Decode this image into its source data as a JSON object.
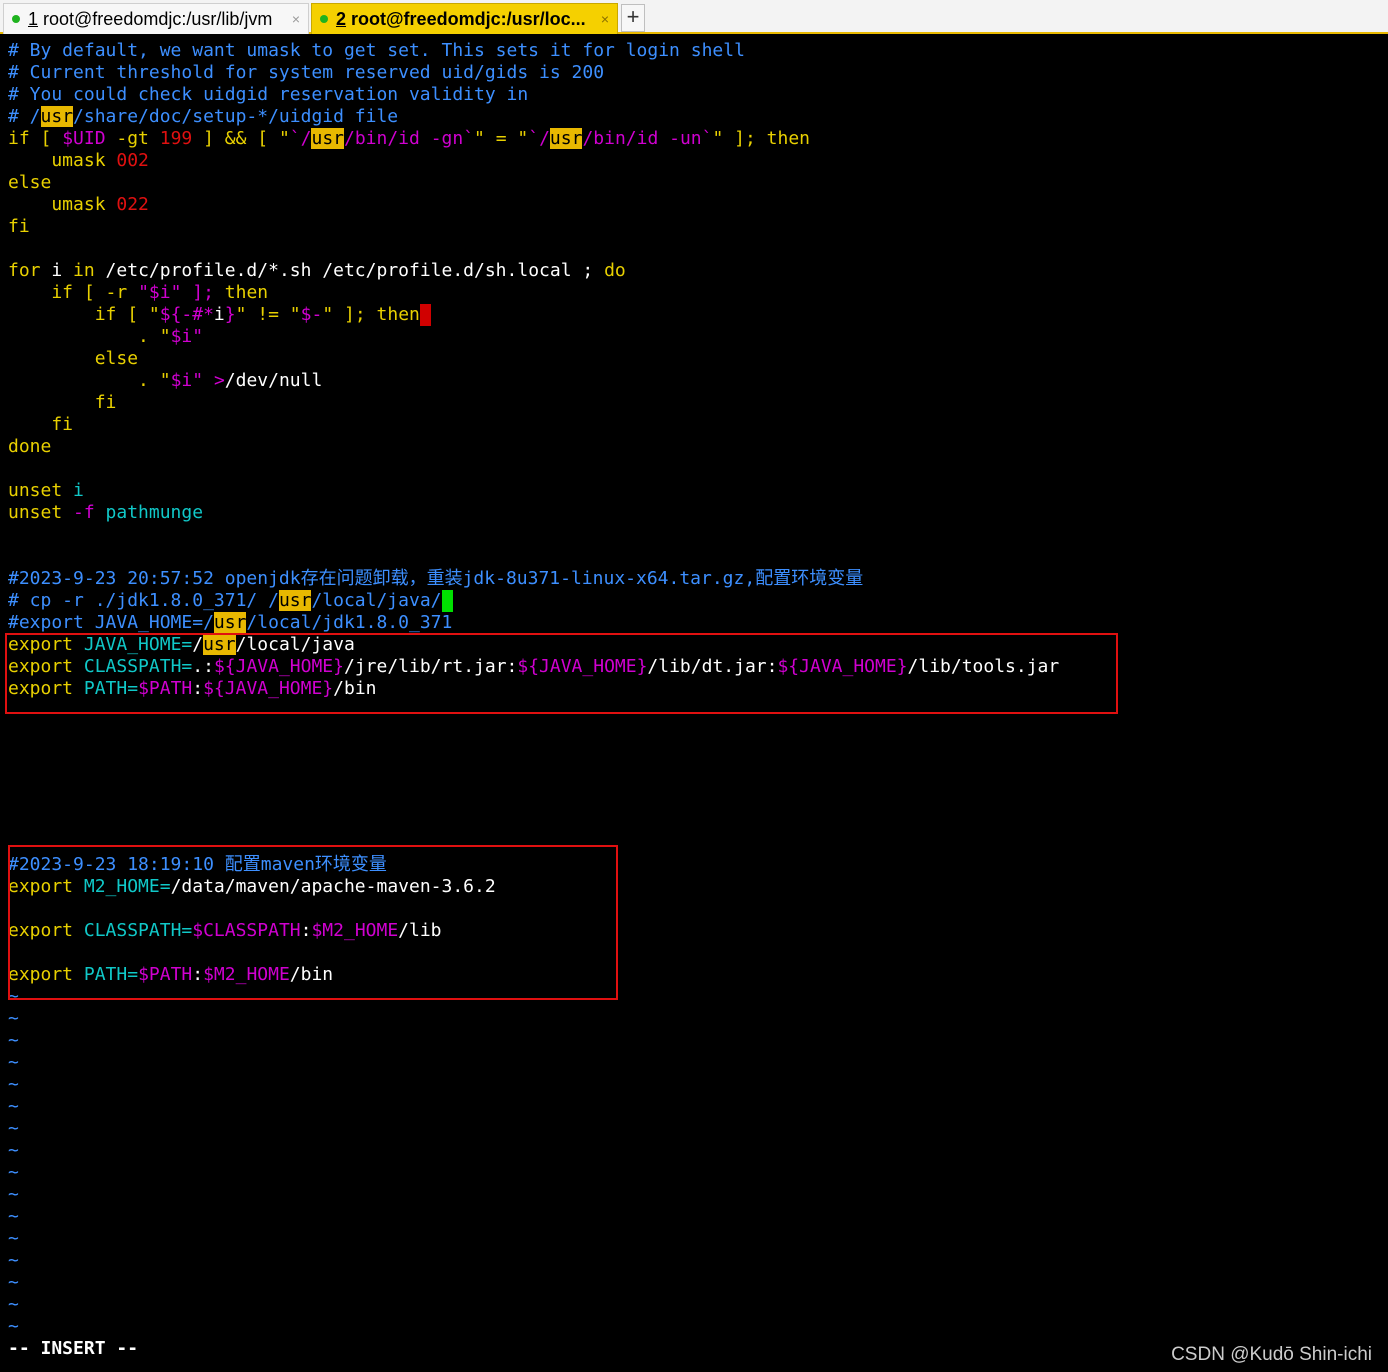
{
  "tabs": [
    {
      "number": "1",
      "title": "root@freedomdjc:/usr/lib/jvm",
      "close": "×"
    },
    {
      "number": "2",
      "title": "root@freedomdjc:/usr/loc...",
      "close": "×"
    }
  ],
  "new_tab": "+",
  "editor": {
    "L1": "# By default, we want umask to get set. This sets it for login shell",
    "L2": "# Current threshold for system reserved uid/gids is 200",
    "L3": "# You could check uidgid reservation validity in",
    "L4": {
      "a": "# /",
      "b": "usr",
      "c": "/share/doc/setup-*/uidgid file"
    },
    "L5": {
      "a": "if [ ",
      "b": "$UID",
      "c": " -gt ",
      "d": "199",
      "e": " ] && [ \"",
      "f": "`/",
      "g": "usr",
      "h": "/bin/id -gn`",
      "i": "\" = \"",
      "j": "`/",
      "k": "usr",
      "l": "/bin/id -un`",
      "m": "\" ]; ",
      "n": "then"
    },
    "L6": {
      "a": "    umask ",
      "b": "002"
    },
    "L7": "else",
    "L8": {
      "a": "    umask ",
      "b": "022"
    },
    "L9": "fi",
    "L11": {
      "a": "for",
      "b": " i ",
      "c": "in",
      "d": " /etc/profile.d/*.sh /etc/profile.d/sh.local ; ",
      "e": "do"
    },
    "L12": {
      "a": "    if",
      "b": " [ ",
      "c": "-r",
      "d": " \"",
      "e": "$i",
      "f": "\" ]; ",
      "g": "then"
    },
    "L13": {
      "a": "        if",
      "b": " [ \"",
      "c": "${-#*",
      "d": "i",
      "e": "}",
      "f": "\" != \"",
      "g": "$-",
      "h": "\" ]; ",
      "i": "then"
    },
    "L14": {
      "a": "            . \"",
      "b": "$i",
      "c": "\""
    },
    "L15": "        else",
    "L16": {
      "a": "            . \"",
      "b": "$i",
      "c": "\" ",
      "d": ">",
      "e": "/dev/null"
    },
    "L17": "        fi",
    "L18": "    fi",
    "L19": "done",
    "L21": {
      "a": "unset",
      "b": " i"
    },
    "L22": {
      "a": "unset",
      "b": " -f",
      "c": " pathmunge"
    },
    "L25": "#2023-9-23 20:57:52 openjdk存在问题卸载，重装jdk-8u371-linux-x64.tar.gz,配置环境变量",
    "L26": {
      "a": "# cp -r ./jdk1.8.0_371/ /",
      "b": "usr",
      "c": "/local/java/"
    },
    "L27": {
      "a": "#export JAVA_HOME=/",
      "b": "usr",
      "c": "/local/jdk1.8.0_371"
    },
    "L28": {
      "a": "export",
      "b": " JAVA_HOME=",
      "c": "/",
      "d": "usr",
      "e": "/local/java"
    },
    "L29": {
      "a": "export",
      "b": " CLASSPATH=",
      "c": ".:",
      "d": "${JAVA_HOME}",
      "e": "/jre/lib/rt.jar:",
      "f": "${JAVA_HOME}",
      "g": "/lib/dt.jar:",
      "h": "${JAVA_HOME}",
      "i": "/lib/tools.jar"
    },
    "L30": {
      "a": "export",
      "b": " PATH=",
      "c": "$PATH",
      "d": ":",
      "e": "${JAVA_HOME}",
      "f": "/bin"
    },
    "L38": "#2023-9-23 18:19:10 配置maven环境变量",
    "L39": {
      "a": "export",
      "b": " M2_HOME=",
      "c": "/data/maven/apache-maven-3.6.2"
    },
    "L41": {
      "a": "export",
      "b": " CLASSPATH=",
      "c": "$CLASSPATH",
      "d": ":",
      "e": "$M2_HOME",
      "f": "/lib"
    },
    "L43": {
      "a": "export",
      "b": " PATH=",
      "c": "$PATH",
      "d": ":",
      "e": "$M2_HOME",
      "f": "/bin"
    },
    "tilde": "~"
  },
  "status_line": "-- INSERT --",
  "watermark": "CSDN @Kudō Shin-ichi",
  "colors": {
    "background": "#000000",
    "comment": "#3d8fff",
    "keyword": "#e8d000",
    "string": "#d000d0",
    "number": "#e01010",
    "cyan": "#10c8c8",
    "search_highlight": "#e8b800",
    "annotation_box": "#e01010",
    "active_tab": "#f5d000"
  }
}
